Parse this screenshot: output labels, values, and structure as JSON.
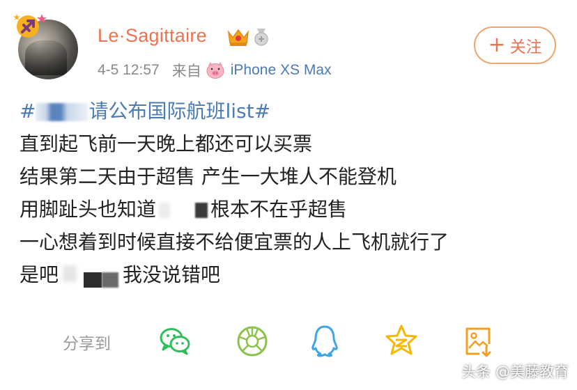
{
  "user": {
    "name": "Le·Sagittaire",
    "avatar_icon": "zodiac-sagittarius-icon",
    "badges": [
      "vip-crown-icon",
      "medal-icon"
    ]
  },
  "meta": {
    "time": "4-5 12:57",
    "from_label": "来自",
    "device_icon": "pig-icon",
    "device": "iPhone XS Max"
  },
  "follow": {
    "plus": "+",
    "label": "关注"
  },
  "post": {
    "topic_prefix": "#",
    "topic_suffix": "请公布国际航班list#",
    "lines": [
      "直到起飞前一天晚上都还可以买票",
      "结果第二天由于超售 产生一大堆人不能登机",
      "用脚趾头也知道",
      "根本不在乎超售",
      "一心想着到时候直接不给便宜票的人上飞机就行了",
      "是吧",
      "我没说错吧"
    ]
  },
  "share": {
    "label": "分享到",
    "targets": [
      "wechat-icon",
      "moments-icon",
      "qq-icon",
      "qzone-icon",
      "save-image-icon"
    ]
  },
  "watermark": "头条 @美藤教育",
  "colors": {
    "username": "#eb7350",
    "link": "#4a7bb5",
    "follow_border": "#f0a36b",
    "wechat": "#2fbf5a",
    "moments": "#8ac24a",
    "qq": "#3ea4e8",
    "qzone": "#f5b800",
    "save": "#f0a020"
  }
}
